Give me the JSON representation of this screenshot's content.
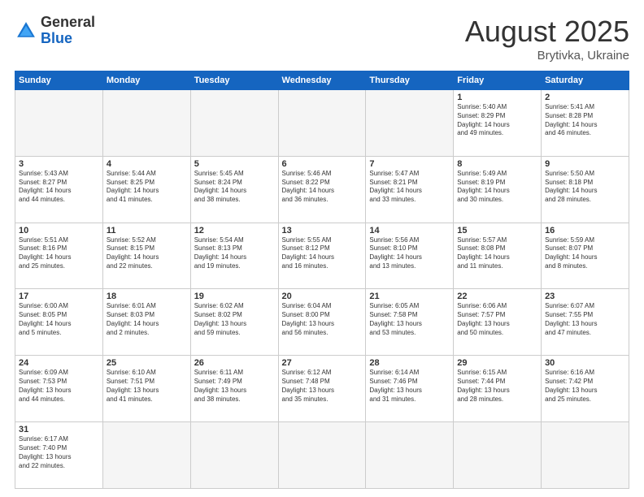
{
  "header": {
    "logo_general": "General",
    "logo_blue": "Blue",
    "title": "August 2025",
    "subtitle": "Brytivka, Ukraine"
  },
  "weekdays": [
    "Sunday",
    "Monday",
    "Tuesday",
    "Wednesday",
    "Thursday",
    "Friday",
    "Saturday"
  ],
  "weeks": [
    [
      {
        "day": "",
        "info": "",
        "empty": true
      },
      {
        "day": "",
        "info": "",
        "empty": true
      },
      {
        "day": "",
        "info": "",
        "empty": true
      },
      {
        "day": "",
        "info": "",
        "empty": true
      },
      {
        "day": "",
        "info": "",
        "empty": true
      },
      {
        "day": "1",
        "info": "Sunrise: 5:40 AM\nSunset: 8:29 PM\nDaylight: 14 hours\nand 49 minutes."
      },
      {
        "day": "2",
        "info": "Sunrise: 5:41 AM\nSunset: 8:28 PM\nDaylight: 14 hours\nand 46 minutes."
      }
    ],
    [
      {
        "day": "3",
        "info": "Sunrise: 5:43 AM\nSunset: 8:27 PM\nDaylight: 14 hours\nand 44 minutes."
      },
      {
        "day": "4",
        "info": "Sunrise: 5:44 AM\nSunset: 8:25 PM\nDaylight: 14 hours\nand 41 minutes."
      },
      {
        "day": "5",
        "info": "Sunrise: 5:45 AM\nSunset: 8:24 PM\nDaylight: 14 hours\nand 38 minutes."
      },
      {
        "day": "6",
        "info": "Sunrise: 5:46 AM\nSunset: 8:22 PM\nDaylight: 14 hours\nand 36 minutes."
      },
      {
        "day": "7",
        "info": "Sunrise: 5:47 AM\nSunset: 8:21 PM\nDaylight: 14 hours\nand 33 minutes."
      },
      {
        "day": "8",
        "info": "Sunrise: 5:49 AM\nSunset: 8:19 PM\nDaylight: 14 hours\nand 30 minutes."
      },
      {
        "day": "9",
        "info": "Sunrise: 5:50 AM\nSunset: 8:18 PM\nDaylight: 14 hours\nand 28 minutes."
      }
    ],
    [
      {
        "day": "10",
        "info": "Sunrise: 5:51 AM\nSunset: 8:16 PM\nDaylight: 14 hours\nand 25 minutes."
      },
      {
        "day": "11",
        "info": "Sunrise: 5:52 AM\nSunset: 8:15 PM\nDaylight: 14 hours\nand 22 minutes."
      },
      {
        "day": "12",
        "info": "Sunrise: 5:54 AM\nSunset: 8:13 PM\nDaylight: 14 hours\nand 19 minutes."
      },
      {
        "day": "13",
        "info": "Sunrise: 5:55 AM\nSunset: 8:12 PM\nDaylight: 14 hours\nand 16 minutes."
      },
      {
        "day": "14",
        "info": "Sunrise: 5:56 AM\nSunset: 8:10 PM\nDaylight: 14 hours\nand 13 minutes."
      },
      {
        "day": "15",
        "info": "Sunrise: 5:57 AM\nSunset: 8:08 PM\nDaylight: 14 hours\nand 11 minutes."
      },
      {
        "day": "16",
        "info": "Sunrise: 5:59 AM\nSunset: 8:07 PM\nDaylight: 14 hours\nand 8 minutes."
      }
    ],
    [
      {
        "day": "17",
        "info": "Sunrise: 6:00 AM\nSunset: 8:05 PM\nDaylight: 14 hours\nand 5 minutes."
      },
      {
        "day": "18",
        "info": "Sunrise: 6:01 AM\nSunset: 8:03 PM\nDaylight: 14 hours\nand 2 minutes."
      },
      {
        "day": "19",
        "info": "Sunrise: 6:02 AM\nSunset: 8:02 PM\nDaylight: 13 hours\nand 59 minutes."
      },
      {
        "day": "20",
        "info": "Sunrise: 6:04 AM\nSunset: 8:00 PM\nDaylight: 13 hours\nand 56 minutes."
      },
      {
        "day": "21",
        "info": "Sunrise: 6:05 AM\nSunset: 7:58 PM\nDaylight: 13 hours\nand 53 minutes."
      },
      {
        "day": "22",
        "info": "Sunrise: 6:06 AM\nSunset: 7:57 PM\nDaylight: 13 hours\nand 50 minutes."
      },
      {
        "day": "23",
        "info": "Sunrise: 6:07 AM\nSunset: 7:55 PM\nDaylight: 13 hours\nand 47 minutes."
      }
    ],
    [
      {
        "day": "24",
        "info": "Sunrise: 6:09 AM\nSunset: 7:53 PM\nDaylight: 13 hours\nand 44 minutes."
      },
      {
        "day": "25",
        "info": "Sunrise: 6:10 AM\nSunset: 7:51 PM\nDaylight: 13 hours\nand 41 minutes."
      },
      {
        "day": "26",
        "info": "Sunrise: 6:11 AM\nSunset: 7:49 PM\nDaylight: 13 hours\nand 38 minutes."
      },
      {
        "day": "27",
        "info": "Sunrise: 6:12 AM\nSunset: 7:48 PM\nDaylight: 13 hours\nand 35 minutes."
      },
      {
        "day": "28",
        "info": "Sunrise: 6:14 AM\nSunset: 7:46 PM\nDaylight: 13 hours\nand 31 minutes."
      },
      {
        "day": "29",
        "info": "Sunrise: 6:15 AM\nSunset: 7:44 PM\nDaylight: 13 hours\nand 28 minutes."
      },
      {
        "day": "30",
        "info": "Sunrise: 6:16 AM\nSunset: 7:42 PM\nDaylight: 13 hours\nand 25 minutes."
      }
    ],
    [
      {
        "day": "31",
        "info": "Sunrise: 6:17 AM\nSunset: 7:40 PM\nDaylight: 13 hours\nand 22 minutes."
      },
      {
        "day": "",
        "info": "",
        "empty": true
      },
      {
        "day": "",
        "info": "",
        "empty": true
      },
      {
        "day": "",
        "info": "",
        "empty": true
      },
      {
        "day": "",
        "info": "",
        "empty": true
      },
      {
        "day": "",
        "info": "",
        "empty": true
      },
      {
        "day": "",
        "info": "",
        "empty": true
      }
    ]
  ]
}
